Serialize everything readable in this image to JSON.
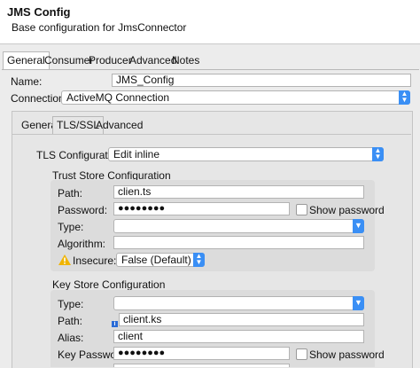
{
  "header": {
    "title": "JMS Config",
    "subtitle": "Base configuration for JmsConnector"
  },
  "main_tabs": [
    "General",
    "Consumer",
    "Producer",
    "Advanced",
    "Notes"
  ],
  "form": {
    "name_label": "Name:",
    "name_value": "JMS_Config",
    "connection_label": "Connection",
    "connection_value": "ActiveMQ Connection"
  },
  "sub_tabs": [
    "General",
    "TLS/SSL",
    "Advanced"
  ],
  "tls": {
    "config_label": "TLS Configuration",
    "config_value": "Edit inline"
  },
  "trust_store": {
    "title": "Trust Store Configuration",
    "path_label": "Path:",
    "path_value": "clien.ts",
    "password_label": "Password:",
    "password_value": "●●●●●●●●",
    "show_password_label": "Show password",
    "type_label": "Type:",
    "type_value": "",
    "algorithm_label": "Algorithm:",
    "algorithm_value": "",
    "insecure_label": "Insecure:",
    "insecure_value": "False (Default)"
  },
  "key_store": {
    "title": "Key Store Configuration",
    "type_label": "Type:",
    "type_value": "",
    "path_label": "Path:",
    "path_value": "client.ks",
    "alias_label": "Alias:",
    "alias_value": "client",
    "key_password_label": "Key Password:",
    "key_password_value": "●●●●●●●●",
    "show_password_label": "Show password"
  },
  "colors": {
    "accent": "#3a8ff5",
    "warning": "#f0b400",
    "info": "#2a6bd6"
  }
}
